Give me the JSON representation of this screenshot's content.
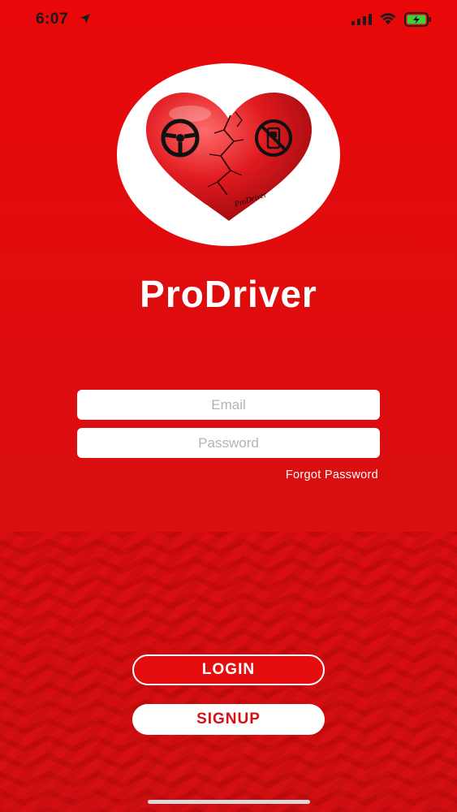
{
  "status_bar": {
    "time": "6:07",
    "icons": [
      "location-arrow-icon",
      "cellular-signal-icon",
      "wifi-icon",
      "battery-charging-icon"
    ]
  },
  "logo": {
    "icon": "heart-logo-icon",
    "text": "ProDriver"
  },
  "app": {
    "title": "ProDriver"
  },
  "form": {
    "email_placeholder": "Email",
    "email_value": "",
    "password_placeholder": "Password",
    "password_value": "",
    "forgot_password_label": "Forgot Password"
  },
  "actions": {
    "login_label": "LOGIN",
    "signup_label": "SIGNUP"
  },
  "colors": {
    "background": "#e20b0d",
    "primary_text": "#ffffff",
    "signup_text": "#d81014",
    "battery_fill": "#3cd13c"
  }
}
